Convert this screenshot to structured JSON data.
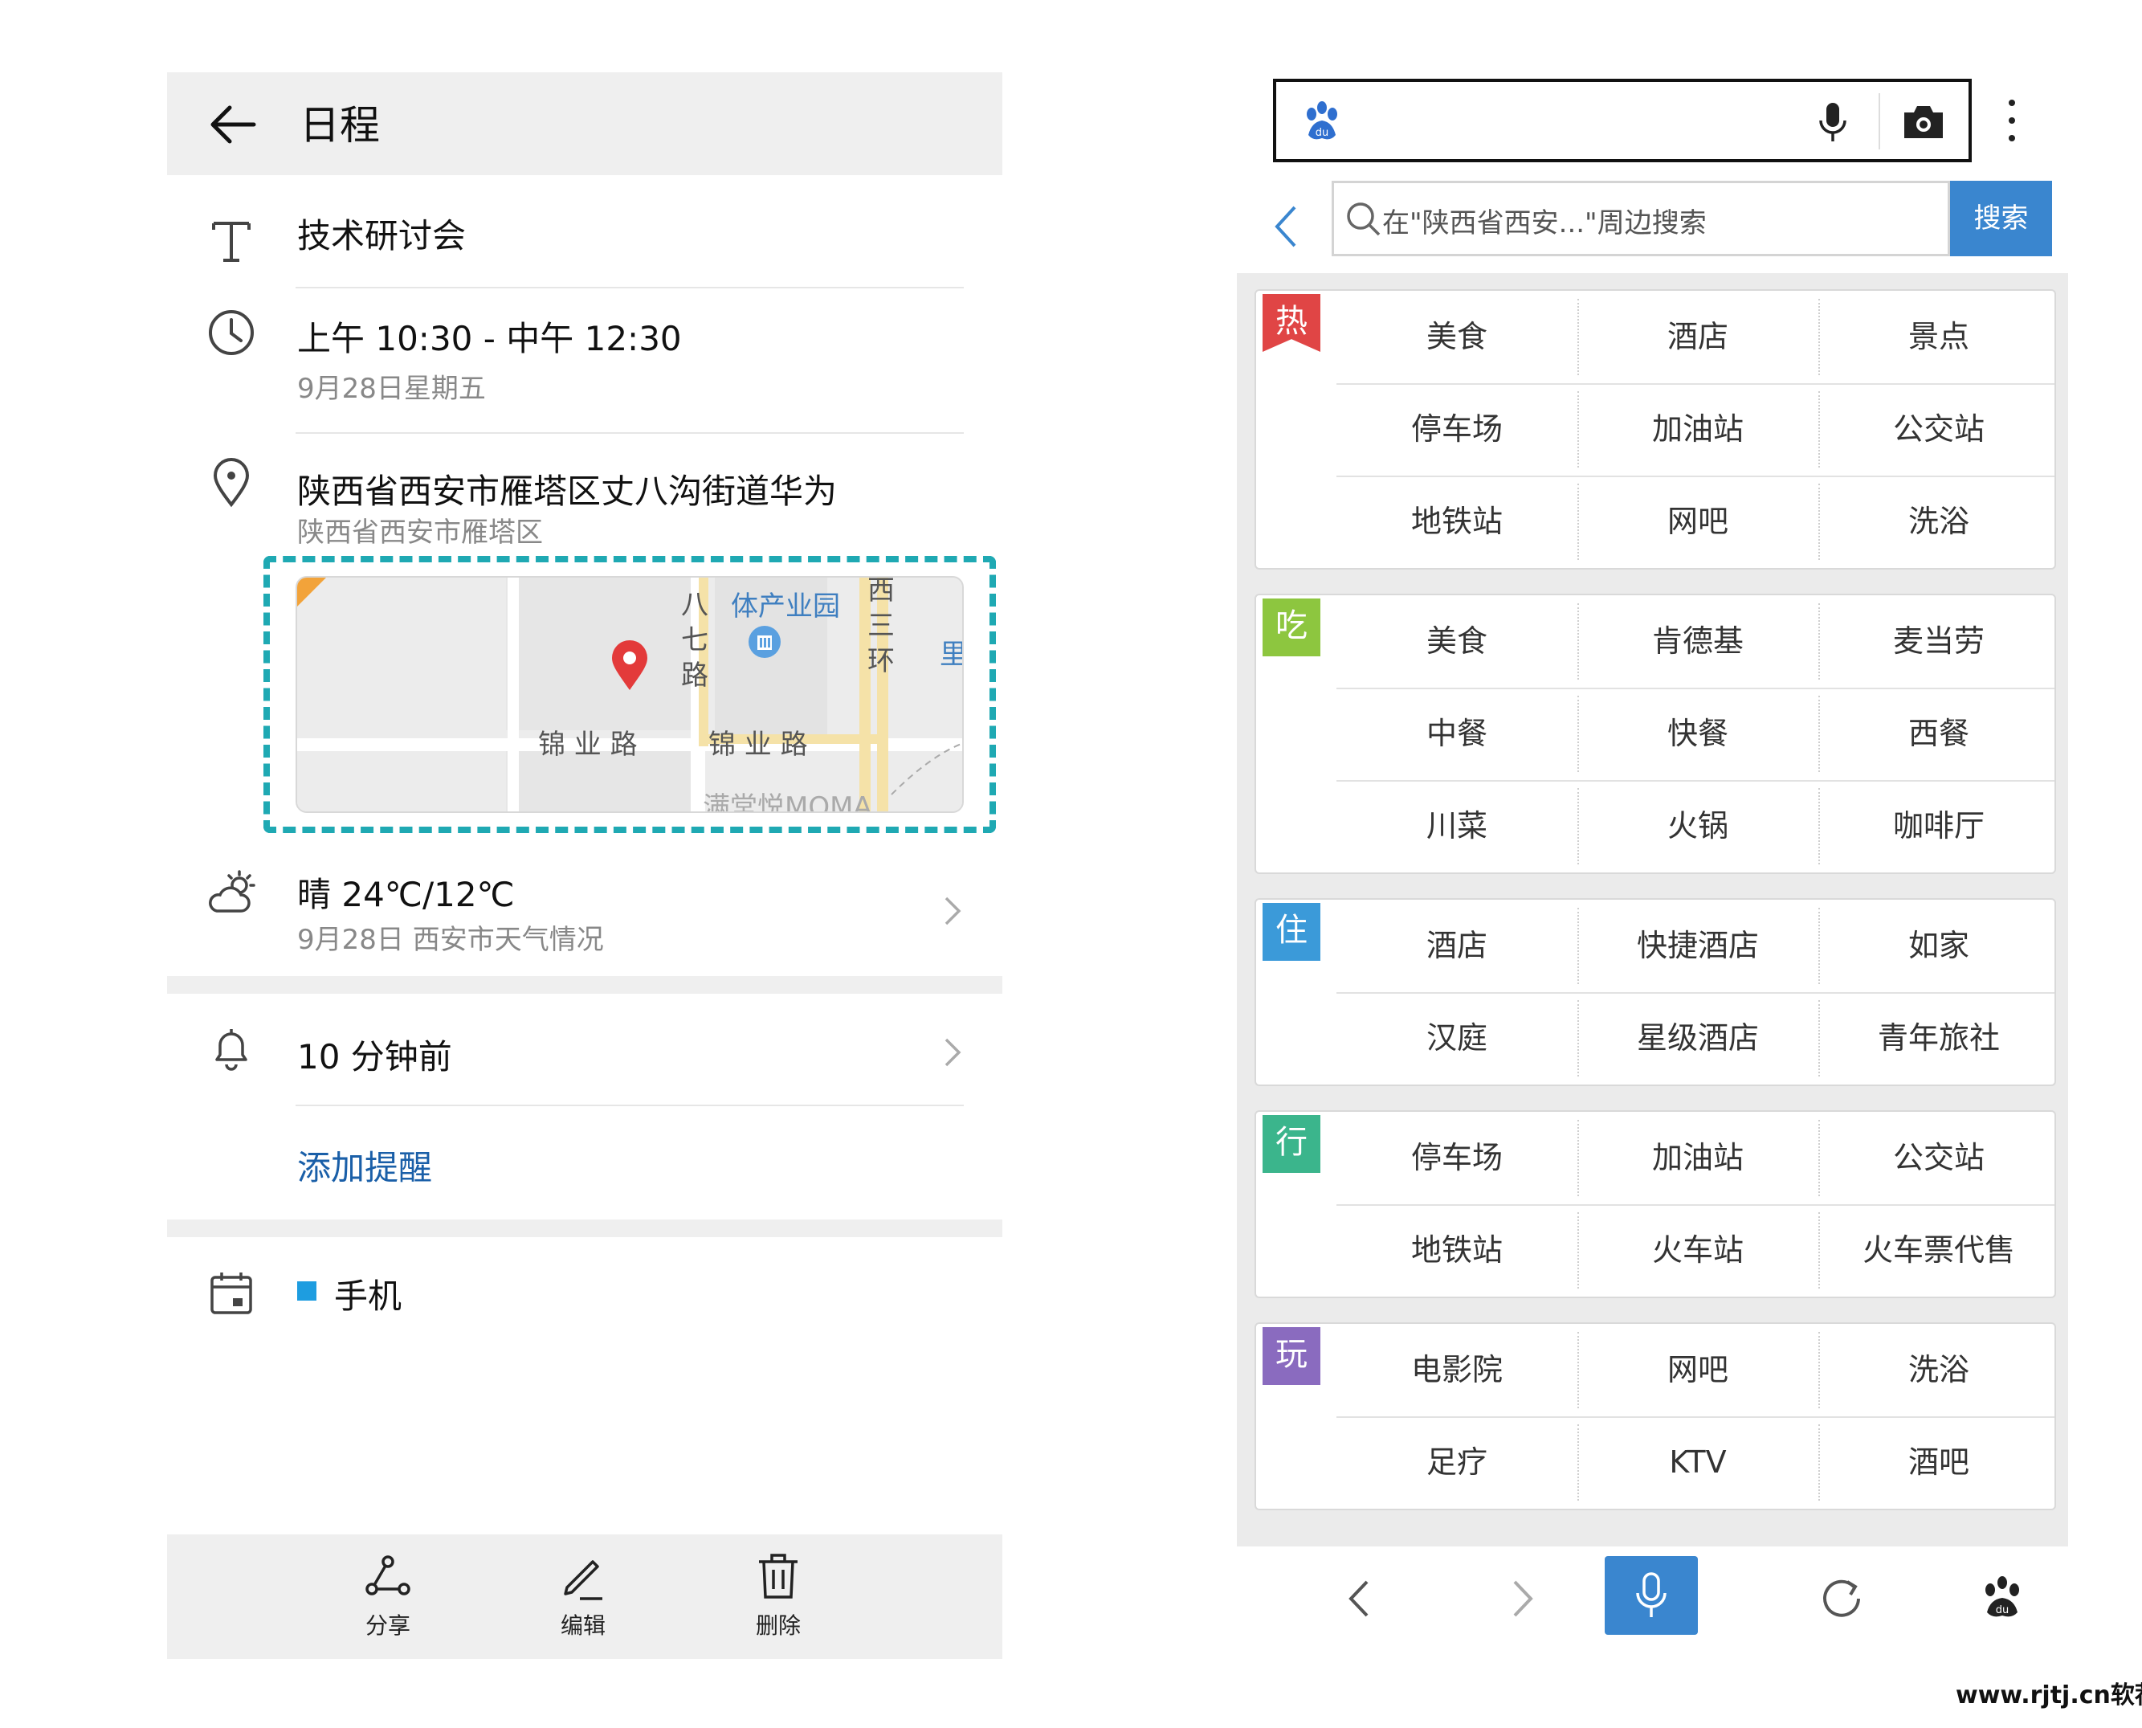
{
  "schedule": {
    "title": "日程",
    "event_name": "技术研讨会",
    "time": "上午 10:30 - 中午 12:30",
    "date": "9月28日星期五",
    "location": "陕西省西安市雁塔区丈八沟街道华为",
    "location_sub": "陕西省西安市雁塔区",
    "map_labels": {
      "park_top": "体产业园",
      "road_vertical": [
        "八",
        "七",
        "路"
      ],
      "road_vertical2": [
        "西",
        "三",
        "环"
      ],
      "road_left": "锦 业 路",
      "road_right": "锦 业 路",
      "bottom": "满堂悦MOMA",
      "edge": "里"
    },
    "weather": "晴 24℃/12℃",
    "weather_sub": "9月28日 西安市天气情况",
    "reminder": "10 分钟前",
    "add_reminder": "添加提醒",
    "calendar": "手机",
    "calendar_color": "#1e9de0",
    "actions": {
      "share": "分享",
      "edit": "编辑",
      "delete": "删除"
    }
  },
  "browser": {
    "search_placeholder": "在\"陕西省西安...\"周边搜索",
    "search_button": "搜索",
    "accent": "#3a86cf",
    "categories": [
      {
        "tag": "热",
        "color": "#e04545",
        "items": [
          "美食",
          "酒店",
          "景点",
          "停车场",
          "加油站",
          "公交站",
          "地铁站",
          "网吧",
          "洗浴"
        ]
      },
      {
        "tag": "吃",
        "color": "#8dc63f",
        "items": [
          "美食",
          "肯德基",
          "麦当劳",
          "中餐",
          "快餐",
          "西餐",
          "川菜",
          "火锅",
          "咖啡厅"
        ]
      },
      {
        "tag": "住",
        "color": "#3b9ad9",
        "items": [
          "酒店",
          "快捷酒店",
          "如家",
          "汉庭",
          "星级酒店",
          "青年旅社"
        ]
      },
      {
        "tag": "行",
        "color": "#3bb58c",
        "items": [
          "停车场",
          "加油站",
          "公交站",
          "地铁站",
          "火车站",
          "火车票代售"
        ]
      },
      {
        "tag": "玩",
        "color": "#8a6bbf",
        "items": [
          "电影院",
          "网吧",
          "洗浴",
          "足疗",
          "KTV",
          "酒吧"
        ]
      }
    ]
  },
  "watermark": "www.rjtj.cn软荐网"
}
